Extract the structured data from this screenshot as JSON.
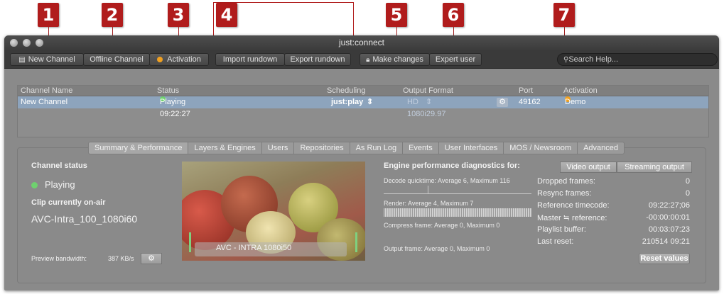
{
  "window": {
    "title": "just:connect"
  },
  "callouts": [
    "1",
    "2",
    "3",
    "4",
    "5",
    "6",
    "7"
  ],
  "toolbar": {
    "new_channel": "New Channel",
    "offline_channel": "Offline Channel",
    "activation": "Activation",
    "import_rundown": "Import rundown",
    "export_rundown": "Export rundown",
    "make_changes": "Make changes",
    "expert_user": "Expert user",
    "search_placeholder": "Search Help..."
  },
  "channel_table": {
    "headers": [
      "Channel Name",
      "Status",
      "Scheduling",
      "Output Format",
      "Port",
      "Activation"
    ],
    "row": {
      "name": "New Channel",
      "status": "Playing 09:22:27",
      "scheduling": "just:play",
      "output_format": "HD 1080i29.97",
      "port": "49162",
      "activation": "Demo"
    }
  },
  "tabs": [
    "Summary & Performance",
    "Layers & Engines",
    "Users",
    "Repositories",
    "As Run Log",
    "Events",
    "User Interfaces",
    "MOS / Newsroom",
    "Advanced"
  ],
  "summary": {
    "channel_status_label": "Channel status",
    "status_value": "Playing",
    "clip_label": "Clip currently on-air",
    "clip_value": "AVC-Intra_100_1080i60",
    "preview_bandwidth_label": "Preview bandwidth:",
    "preview_bandwidth_value": "387 KB/s",
    "preview_overlay": "AVC - INTRA 1080i50"
  },
  "diagnostics": {
    "title": "Engine performance diagnostics for:",
    "video_output": "Video output",
    "streaming_output": "Streaming output",
    "decode": "Decode quicktime: Average 6, Maximum 116",
    "render": "Render: Average 4, Maximum 7",
    "compress": "Compress frame: Average 0, Maximum 0",
    "output": "Output frame: Average 0, Maximum 0"
  },
  "stats": [
    {
      "label": "Dropped frames:",
      "value": "0"
    },
    {
      "label": "Resync frames:",
      "value": "0"
    },
    {
      "label": "Reference timecode:",
      "value": "09:22:27;06"
    },
    {
      "label": "Master ≒ reference:",
      "value": "-00:00:00:01"
    },
    {
      "label": "Playlist buffer:",
      "value": "00:03:07:23"
    },
    {
      "label": "Last reset:",
      "value": "210514 09:21"
    }
  ],
  "reset_values": "Reset values",
  "colors": {
    "callout": "#b01c1c",
    "selected_row": "#8da4bd",
    "status_green": "#6fd16f",
    "activation_orange": "#f0a020"
  }
}
